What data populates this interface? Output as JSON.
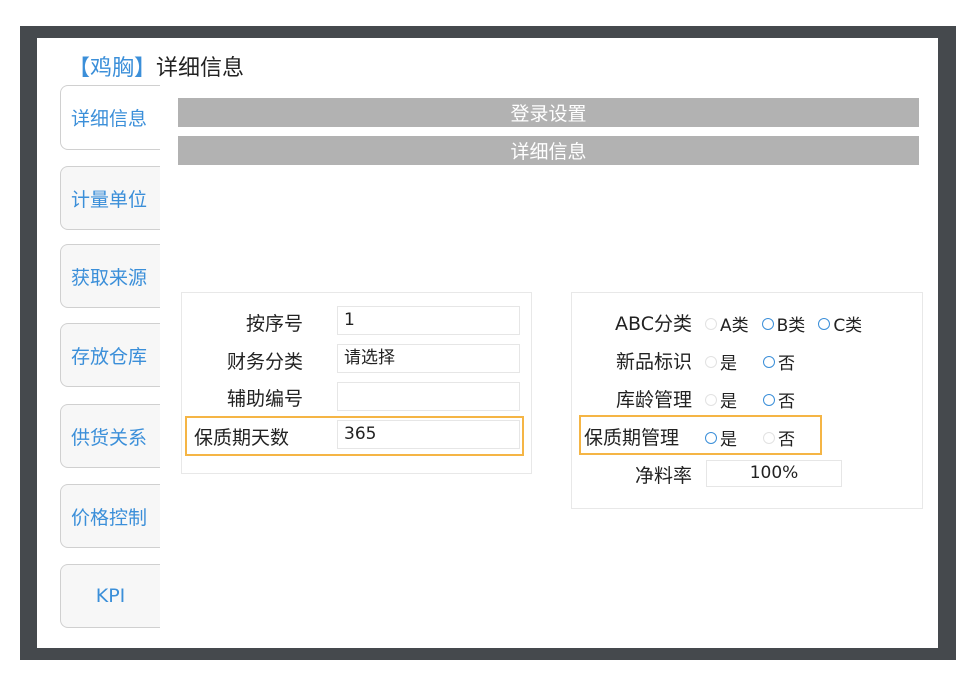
{
  "header": {
    "tag": "【鸡胸】",
    "title": "详细信息"
  },
  "tabs": [
    {
      "label": "详细信息",
      "active": true
    },
    {
      "label": "计量单位"
    },
    {
      "label": "获取来源"
    },
    {
      "label": "存放仓库"
    },
    {
      "label": "供货关系"
    },
    {
      "label": "价格控制"
    },
    {
      "label": "KPI"
    }
  ],
  "bars": {
    "login_settings": "登录设置",
    "details": "详细信息"
  },
  "left_form": {
    "sort_no": {
      "label": "按序号",
      "value": "1"
    },
    "finance_category": {
      "label": "财务分类",
      "value": "请选择"
    },
    "aux_code": {
      "label": "辅助编号",
      "value": ""
    },
    "shelf_days": {
      "label": "保质期天数",
      "value": "365"
    }
  },
  "right_form": {
    "abc": {
      "label": "ABC分类",
      "options": [
        "A类",
        "B类",
        "C类"
      ]
    },
    "new_flag": {
      "label": "新品标识",
      "options": [
        "是",
        "否"
      ]
    },
    "age_mgmt": {
      "label": "库龄管理",
      "options": [
        "是",
        "否"
      ]
    },
    "shelf_mgmt": {
      "label": "保质期管理",
      "options": [
        "是",
        "否"
      ]
    },
    "net_rate": {
      "label": "净料率",
      "value": "100%"
    }
  },
  "colors": {
    "accent": "#3b8fd9",
    "highlight": "#f5b545",
    "bar": "#b2b2b2",
    "frame": "#45494d"
  }
}
